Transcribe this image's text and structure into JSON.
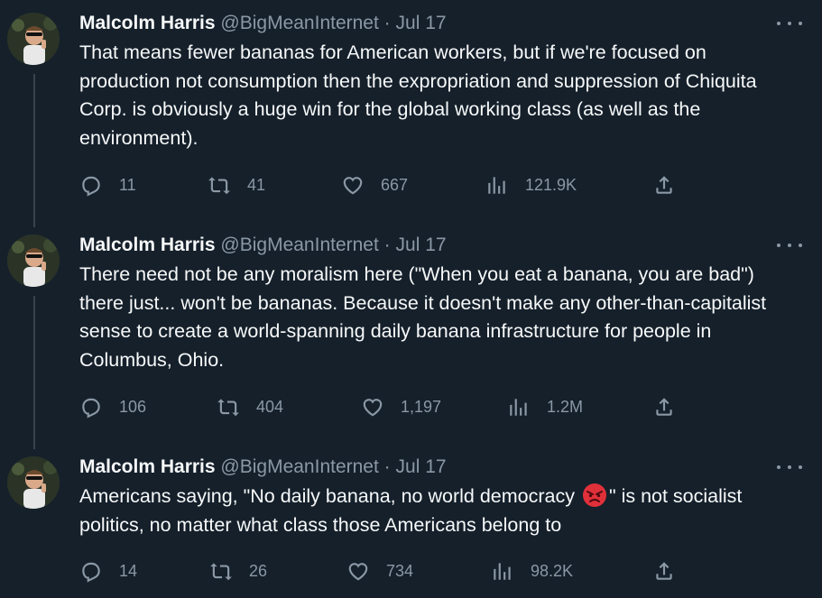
{
  "tweets": [
    {
      "name": "Malcolm Harris",
      "handle": "@BigMeanInternet",
      "sep": "·",
      "date": "Jul 17",
      "text": "That means fewer bananas for American workers, but if we're focused on production not consumption then the expropriation and suppression of Chiquita Corp. is obviously a huge win for the global working class (as well as the environment).",
      "replies": "11",
      "reposts": "41",
      "likes": "667",
      "views": "121.9K"
    },
    {
      "name": "Malcolm Harris",
      "handle": "@BigMeanInternet",
      "sep": "·",
      "date": "Jul 17",
      "text": "There need not be any moralism here (\"When you eat a banana, you are bad\") there just... won't be bananas. Because it doesn't make any other-than-capitalist sense to create a world-spanning daily banana infrastructure for people in Columbus, Ohio.",
      "replies": "106",
      "reposts": "404",
      "likes": "1,197",
      "views": "1.2M"
    },
    {
      "name": "Malcolm Harris",
      "handle": "@BigMeanInternet",
      "sep": "·",
      "date": "Jul 17",
      "text_before": "Americans saying, \"No daily banana, no world democracy ",
      "text_after": "\" is not socialist politics, no matter what class those Americans belong to",
      "emoji": "angry-face-emoji",
      "replies": "14",
      "reposts": "26",
      "likes": "734",
      "views": "98.2K"
    }
  ],
  "icons": {
    "reply": "reply-icon",
    "repost": "repost-icon",
    "like": "like-icon",
    "views": "views-icon",
    "share": "share-icon",
    "more": "more-icon"
  },
  "colors": {
    "background": "#15202b",
    "text": "#f7f9f9",
    "secondary": "#8b98a5",
    "thread_line": "#38444d"
  }
}
